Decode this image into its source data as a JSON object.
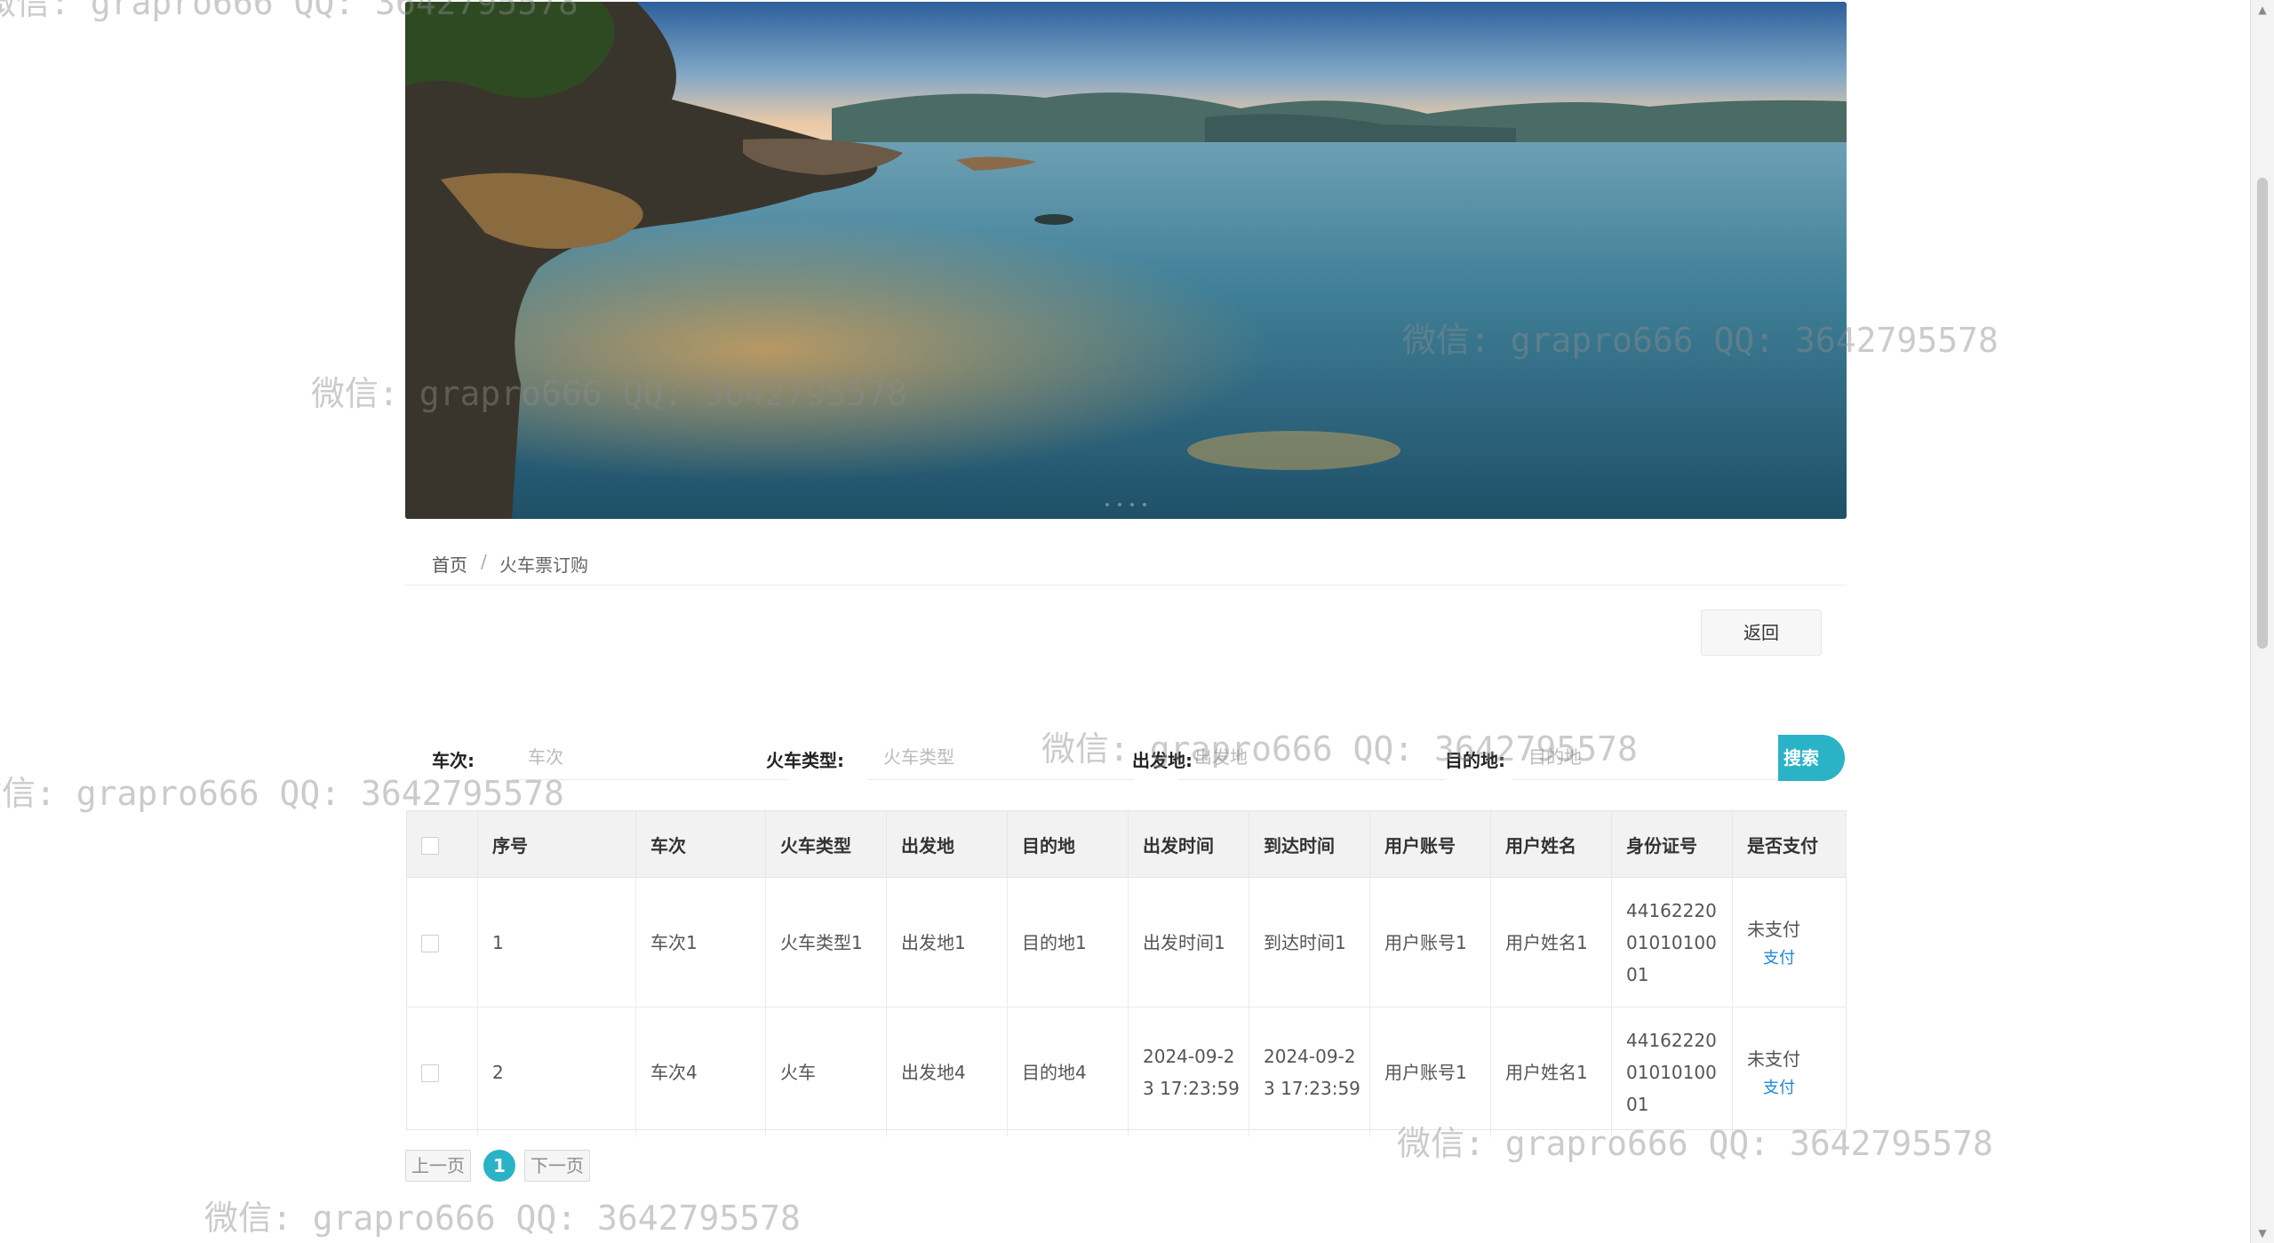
{
  "breadcrumb": {
    "home": "首页",
    "separator": "/",
    "current": "火车票订购"
  },
  "actions": {
    "back": "返回"
  },
  "search": {
    "train_no_label": "车次:",
    "train_no_placeholder": "车次",
    "train_type_label": "火车类型:",
    "train_type_placeholder": "火车类型",
    "origin_label": "出发地:",
    "origin_placeholder": "出发地",
    "destination_label": "目的地:",
    "destination_placeholder": "目的地",
    "button": "搜索"
  },
  "table": {
    "headers": [
      "序号",
      "车次",
      "火车类型",
      "出发地",
      "目的地",
      "出发时间",
      "到达时间",
      "用户账号",
      "用户姓名",
      "身份证号",
      "是否支付"
    ],
    "rows": [
      {
        "index": "1",
        "train_no": "车次1",
        "train_type": "火车类型1",
        "origin": "出发地1",
        "destination": "目的地1",
        "depart_time": "出发时间1",
        "arrive_time": "到达时间1",
        "account": "用户账号1",
        "name": "用户姓名1",
        "id_number": "441622200101010001",
        "paid": "未支付",
        "pay_action": "支付"
      },
      {
        "index": "2",
        "train_no": "车次4",
        "train_type": "火车",
        "origin": "出发地4",
        "destination": "目的地4",
        "depart_time": "2024-09-23 17:23:59",
        "arrive_time": "2024-09-23 17:23:59",
        "account": "用户账号1",
        "name": "用户姓名1",
        "id_number": "441622200101010001",
        "paid": "未支付",
        "pay_action": "支付"
      }
    ]
  },
  "pagination": {
    "prev": "上一页",
    "current": "1",
    "next": "下一页"
  },
  "watermark": {
    "text": "微信: grapro666 QQ: 3642795578"
  },
  "colors": {
    "accent": "#2ab3c6",
    "link": "#1e88d6"
  }
}
